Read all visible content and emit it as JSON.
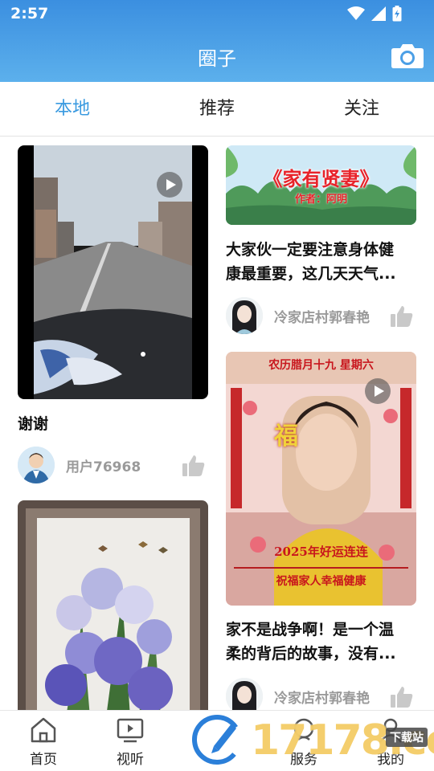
{
  "status": {
    "time": "2:57"
  },
  "header": {
    "title": "圈子"
  },
  "tabs": [
    {
      "label": "本地",
      "active": true
    },
    {
      "label": "推荐",
      "active": false
    },
    {
      "label": "关注",
      "active": false
    }
  ],
  "feed": {
    "left": [
      {
        "title": "谢谢",
        "author": "用户76968",
        "type": "video"
      },
      {
        "type": "image"
      }
    ],
    "right": [
      {
        "banner_text": "《家有贤妻》",
        "banner_subtext": "作者：阿明",
        "title_line1": "大家伙一定要注意身体健",
        "title_line2": "康最重要，这几天天气...",
        "author": "冷家店村郭春艳",
        "type": "image"
      },
      {
        "poster_top": "农历腊月十九  星期六",
        "poster_blessing": "福",
        "poster_year": "2025年好运连连",
        "poster_bottom": "祝福家人幸福健康",
        "title_line1": "家不是战争啊！是一个温",
        "title_line2": "柔的背后的故事，没有...",
        "author": "冷家店村郭春艳",
        "type": "video"
      }
    ]
  },
  "bottom_nav": [
    {
      "label": "首页",
      "icon": "home-icon"
    },
    {
      "label": "视听",
      "icon": "tv-icon"
    },
    {
      "label": "",
      "icon": "publish-icon"
    },
    {
      "label": "服务",
      "icon": "service-icon"
    },
    {
      "label": "我的",
      "icon": "user-icon"
    }
  ],
  "watermark": {
    "text": "17178.com",
    "badge": "下载站"
  },
  "colors": {
    "accent": "#3a9ae0",
    "header_top": "#3b8fe0",
    "header_bottom": "#5cb0ec"
  }
}
